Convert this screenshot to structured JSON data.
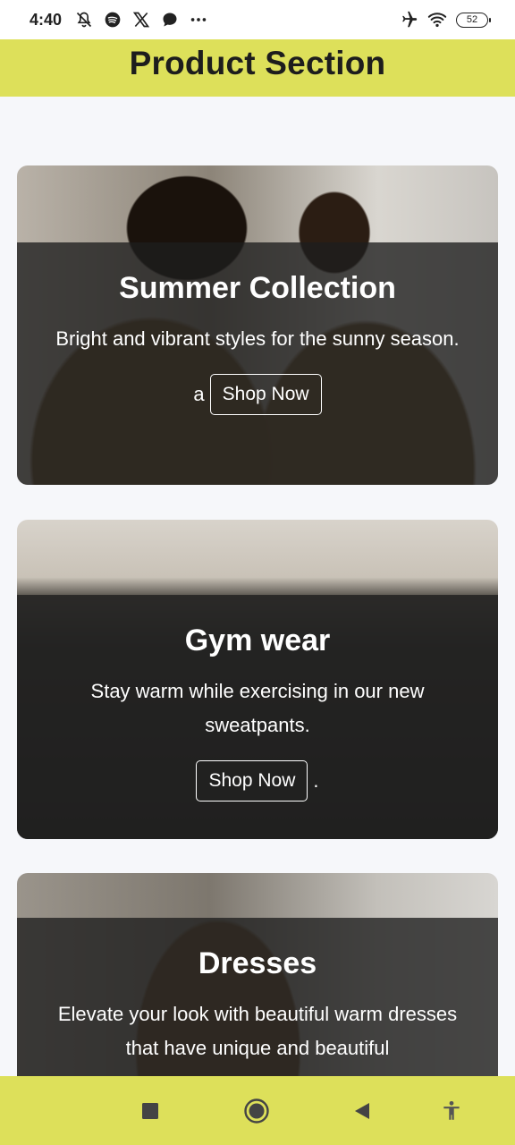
{
  "status_bar": {
    "time": "4:40",
    "battery": "52",
    "icons": [
      "mute-icon",
      "spotify-icon",
      "x-icon",
      "chat-bubble-icon",
      "more-dots-icon",
      "airplane-icon",
      "wifi-icon",
      "battery-icon"
    ]
  },
  "header": {
    "title": "Product Section"
  },
  "cards": [
    {
      "title": "Summer Collection",
      "description": "Bright and vibrant styles for the sunny season.",
      "cta_prefix": "a",
      "button_label": "Shop Now",
      "cta_suffix": ""
    },
    {
      "title": "Gym wear",
      "description": "Stay warm while exercising in our new sweatpants.",
      "cta_prefix": "",
      "button_label": "Shop Now",
      "cta_suffix": "."
    },
    {
      "title": "Dresses",
      "description": "Elevate your look with beautiful warm dresses that have unique and beautiful",
      "cta_prefix": "",
      "button_label": "",
      "cta_suffix": ""
    }
  ],
  "nav_bar": {
    "icons": [
      "square-recents-icon",
      "circle-home-icon",
      "triangle-back-icon",
      "accessibility-icon"
    ]
  },
  "colors": {
    "accent": "#dde05a",
    "overlay": "#1e1e1e",
    "background": "#f6f7fa"
  }
}
